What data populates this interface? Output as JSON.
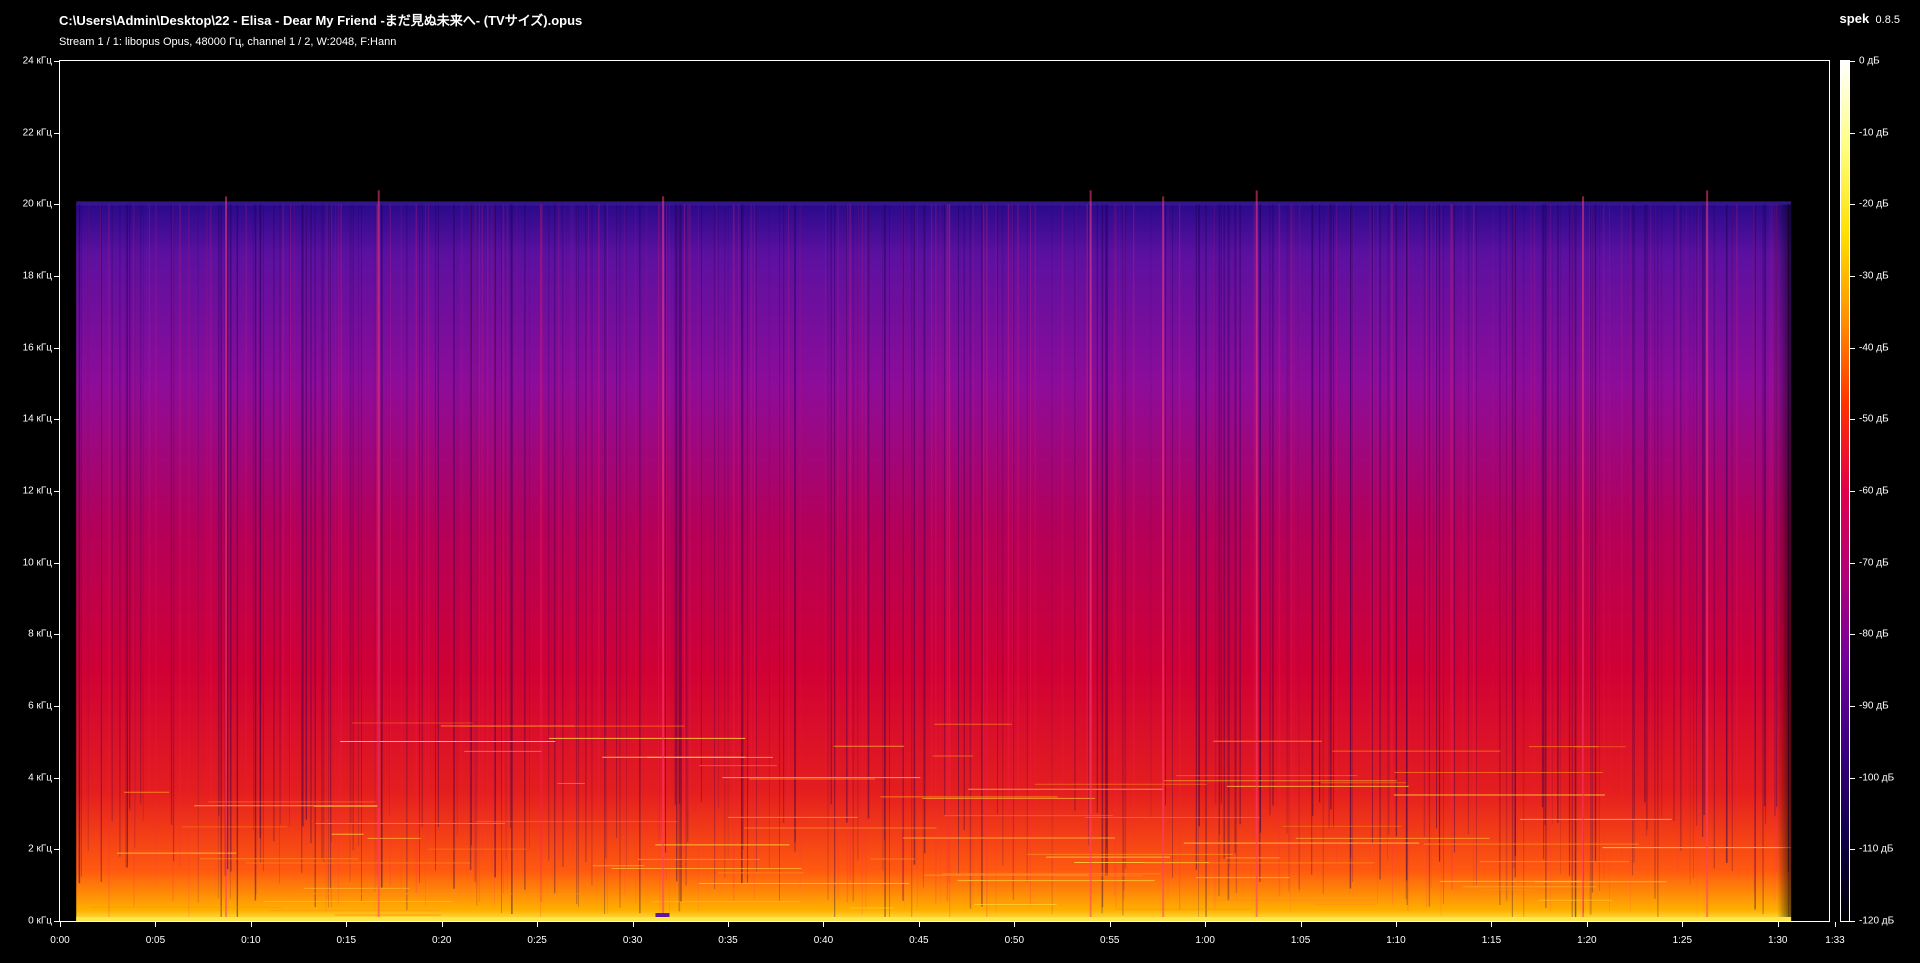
{
  "window": {
    "file_path": "C:\\Users\\Admin\\Desktop\\22 - Elisa - Dear My Friend -まだ見ぬ未来へ- (TVサイズ).opus",
    "stream_info": "Stream 1 / 1: libopus Opus, 48000 Гц, channel 1 / 2, W:2048, F:Hann",
    "app_name": "spek",
    "app_version": "0.8.5"
  },
  "chart_data": {
    "type": "heatmap",
    "title": "",
    "y_axis": {
      "labels": [
        "24 кГц",
        "22 кГц",
        "20 кГц",
        "18 кГц",
        "16 кГц",
        "14 кГц",
        "12 кГц",
        "10 кГц",
        "8 кГц",
        "6 кГц",
        "4 кГц",
        "2 кГц",
        "0 кГц"
      ],
      "values_khz": [
        24,
        22,
        20,
        18,
        16,
        14,
        12,
        10,
        8,
        6,
        4,
        2,
        0
      ],
      "range_khz": [
        0,
        24
      ]
    },
    "x_axis": {
      "labels": [
        "0:00",
        "0:05",
        "0:10",
        "0:15",
        "0:20",
        "0:25",
        "0:30",
        "0:35",
        "0:40",
        "0:45",
        "0:50",
        "0:55",
        "1:00",
        "1:05",
        "1:10",
        "1:15",
        "1:20",
        "1:25",
        "1:30",
        "1:33"
      ],
      "values_s": [
        0,
        5,
        10,
        15,
        20,
        25,
        30,
        35,
        40,
        45,
        50,
        55,
        60,
        65,
        70,
        75,
        80,
        85,
        90,
        93
      ],
      "range_s": [
        0,
        93
      ]
    },
    "color_scale": {
      "labels": [
        "0 дБ",
        "-10 дБ",
        "-20 дБ",
        "-30 дБ",
        "-40 дБ",
        "-50 дБ",
        "-60 дБ",
        "-70 дБ",
        "-80 дБ",
        "-90 дБ",
        "-100 дБ",
        "-110 дБ",
        "-120 дБ"
      ],
      "values_db": [
        0,
        -10,
        -20,
        -30,
        -40,
        -50,
        -60,
        -70,
        -80,
        -90,
        -100,
        -110,
        -120
      ],
      "range_db": [
        -120,
        0
      ],
      "colors": [
        "#ffffff",
        "#ffff80",
        "#ffe000",
        "#ff9000",
        "#ff3000",
        "#e0004a",
        "#b0007a",
        "#70009a",
        "#3a0080",
        "#10004a",
        "#000000"
      ]
    },
    "signal": {
      "content_start_s": 0.85,
      "content_end_s": 90.7,
      "lowpass_cutoff_khz": 20,
      "transients_s": [
        8.7,
        16.7,
        31.6,
        54.0,
        57.8,
        62.7,
        79.8,
        86.3
      ]
    }
  }
}
